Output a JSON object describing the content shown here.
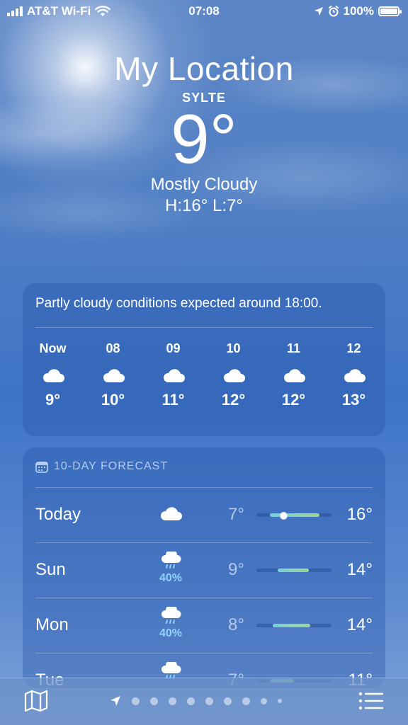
{
  "status_bar": {
    "carrier": "AT&T Wi-Fi",
    "time": "07:08",
    "battery": "100%"
  },
  "location": {
    "title": "My Location",
    "place": "SYLTE",
    "temperature": "9°",
    "condition": "Mostly Cloudy",
    "high_low": "H:16°  L:7°"
  },
  "hourly": {
    "summary": "Partly cloudy conditions expected around 18:00.",
    "items": [
      {
        "time": "Now",
        "icon": "cloud-icon",
        "temp": "9°"
      },
      {
        "time": "08",
        "icon": "cloud-icon",
        "temp": "10°"
      },
      {
        "time": "09",
        "icon": "cloud-icon",
        "temp": "11°"
      },
      {
        "time": "10",
        "icon": "cloud-icon",
        "temp": "12°"
      },
      {
        "time": "11",
        "icon": "cloud-icon",
        "temp": "12°"
      },
      {
        "time": "12",
        "icon": "cloud-icon",
        "temp": "13°"
      }
    ]
  },
  "daily": {
    "header": "10-DAY FORECAST",
    "rows": [
      {
        "day": "Today",
        "icon": "cloud-icon",
        "pop": "",
        "low": "7°",
        "high": "16°",
        "range_start": 0.18,
        "range_end": 0.84,
        "current": 0.35
      },
      {
        "day": "Sun",
        "icon": "cloud-rain-icon",
        "pop": "40%",
        "low": "9°",
        "high": "14°",
        "range_start": 0.28,
        "range_end": 0.7
      },
      {
        "day": "Mon",
        "icon": "cloud-rain-icon",
        "pop": "40%",
        "low": "8°",
        "high": "14°",
        "range_start": 0.22,
        "range_end": 0.72
      },
      {
        "day": "Tue",
        "icon": "cloud-rain-icon",
        "pop": "",
        "low": "7°",
        "high": "11°",
        "range_start": 0.18,
        "range_end": 0.5
      }
    ]
  },
  "bottom_bar": {
    "pages": 9,
    "colors": {
      "accent": "#76d0d8",
      "pop": "#8fd4ff"
    }
  }
}
